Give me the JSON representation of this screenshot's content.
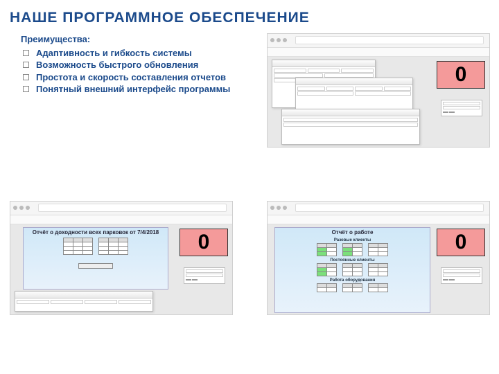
{
  "title": "НАШЕ ПРОГРАММНОЕ ОБЕСПЕЧЕНИЕ",
  "advantages": {
    "heading": "Преимущества:",
    "items": [
      "Адаптивность и гибкость системы",
      "Возможность быстрого обновления",
      "Простота и скорость составления отчетов",
      "Понятный внешний интерфейс программы"
    ]
  },
  "zero_badge": "0",
  "report_left": {
    "title": "Отчёт о доходности всех парковок от 7/4/2018"
  },
  "report_right": {
    "title": "Отчёт о работе",
    "section1": "Разовые клиенты",
    "section2": "Постоянные клиенты",
    "section3": "Работа оборудования"
  }
}
